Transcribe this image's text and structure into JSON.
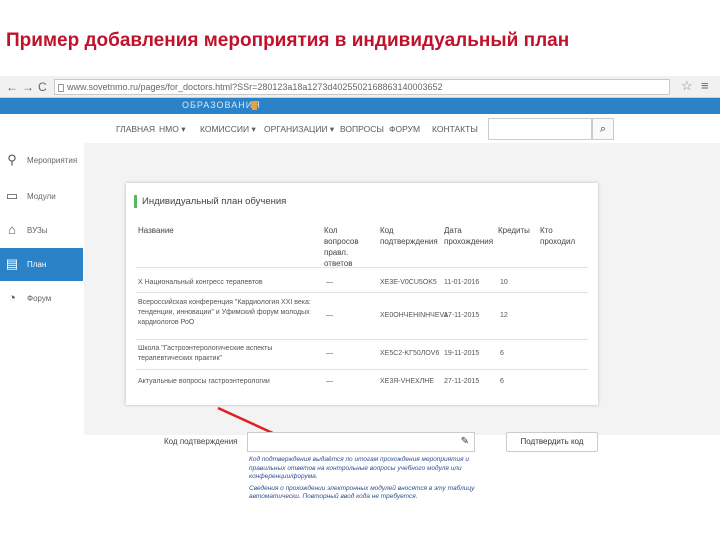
{
  "slide": {
    "title": "Пример добавления мероприятия в индивидуальный план"
  },
  "browser": {
    "back": "←",
    "forward": "→",
    "reload": "C",
    "url": "www.sovetnmo.ru/pages/for_doctors.html?SSr=280123a18a1273d4025502168863140003652",
    "star": "☆",
    "menu": "≡"
  },
  "site": {
    "logo_text": "ОБРАЗОВАНИЯ"
  },
  "topnav": {
    "items": [
      "ГЛАВНАЯ",
      "НМО ▾",
      "КОМИССИИ ▾",
      "ОРГАНИЗАЦИИ ▾",
      "ВОПРОСЫ",
      "ФОРУМ",
      "КОНТАКТЫ"
    ],
    "search_placeholder": "",
    "search_icon": "⌕"
  },
  "sidebar": {
    "items": [
      {
        "label": "Мероприятия",
        "icon": "person-icon",
        "glyph": "⚲"
      },
      {
        "label": "Модули",
        "icon": "monitor-icon",
        "glyph": "▭"
      },
      {
        "label": "ВУЗы",
        "icon": "institution-icon",
        "glyph": "⌂"
      },
      {
        "label": "План",
        "icon": "plan-icon",
        "glyph": "▤"
      },
      {
        "label": "Форум",
        "icon": "chat-icon",
        "glyph": "◔"
      }
    ]
  },
  "panel": {
    "title": "Индивидуальный план обучения",
    "headers": {
      "name": "Название",
      "questions": "Кол вопросов правл. ответов",
      "code": "Код подтверждения",
      "date": "Дата прохождения",
      "credits": "Кредиты",
      "passed": "Кто проходил"
    },
    "rows": [
      {
        "name": "X Национальный конгресс терапевтов",
        "questions": "—",
        "code": "XE3E-V0CU5OK5",
        "date": "11-01-2016",
        "credits": "10"
      },
      {
        "name": "Всероссийская конференция \"Кардиология XXI века: тенденции, инновации\" и Уфимский форум молодых кардиологов РоО",
        "questions": "—",
        "code": "XE0OHЧEHINHЧEVA",
        "date": "17-11-2015",
        "credits": "12"
      },
      {
        "name": "Школа \"Гастроэнтерологические аспекты терапевтических практик\"",
        "questions": "—",
        "code": "XE5C2-KГ50ЛOV6",
        "date": "19-11-2015",
        "credits": "6"
      },
      {
        "name": "Актуальные вопросы гастроэнтерологии",
        "questions": "—",
        "code": "XE3Я-VHEXЛHE",
        "date": "27-11-2015",
        "credits": "6"
      }
    ]
  },
  "form": {
    "code_label": "Код подтверждения",
    "code_value": "",
    "confirm_label": "Подтвердить код",
    "help_1": "Код подтверждения выдаётся по итогам прохождения мероприятия и правильных ответов на контрольные вопросы учебного модуля или конференции/форума.",
    "help_2": "Сведения о прохождении электронных модулей вносятся в эту таблицу автоматически. Повторный ввод кода не требуется."
  },
  "colors": {
    "accent": "#2b82c6",
    "title_red": "#c0122a",
    "arrow_red": "#e01f1f",
    "help_blue": "#2f4f8f"
  }
}
